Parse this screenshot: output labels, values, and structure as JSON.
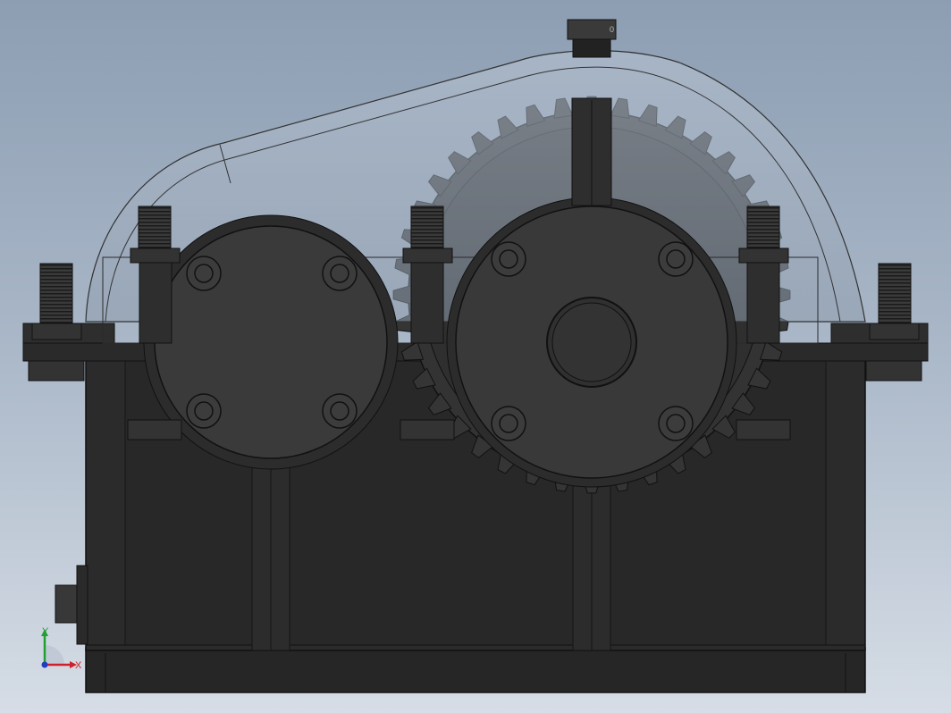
{
  "viewport": {
    "background_top": "#8d9eb3",
    "background_bottom": "#d6dde6",
    "model_color": "#2a2a2a",
    "edge_color": "#111111",
    "transparent_cover_color": "#a9b7c6"
  },
  "drain_plug": {
    "label": "0"
  },
  "triad": {
    "x_label": "X",
    "y_label": "Y",
    "x_color": "#d0202a",
    "y_color": "#20a030",
    "z_color": "#1f3fc0"
  }
}
